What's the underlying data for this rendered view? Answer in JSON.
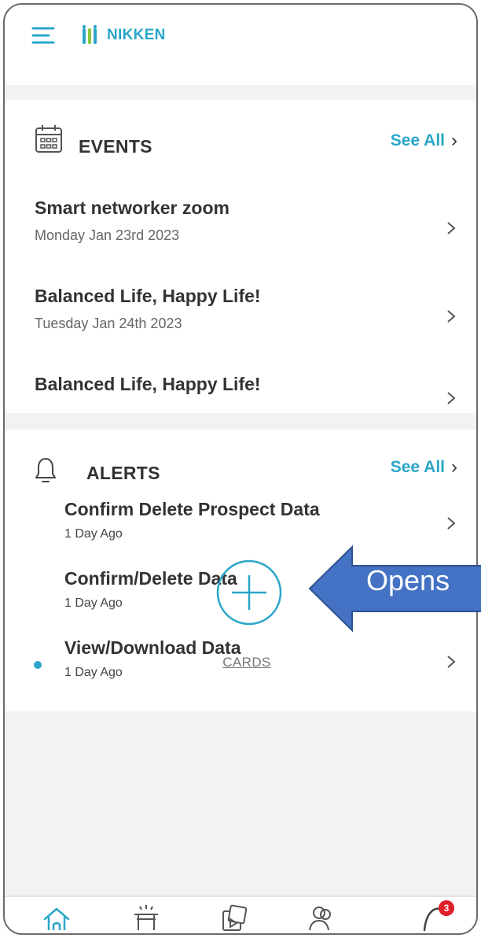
{
  "header": {
    "logo_text": "NIKKEN"
  },
  "events": {
    "title": "EVENTS",
    "see_all": "See All",
    "items": [
      {
        "title": "Smart networker zoom",
        "date": "Monday Jan 23rd 2023"
      },
      {
        "title": "Balanced Life, Happy Life!",
        "date": "Tuesday Jan 24th 2023"
      },
      {
        "title": "Balanced Life, Happy Life!",
        "date": ""
      }
    ]
  },
  "alerts": {
    "title": "ALERTS",
    "see_all": "See All",
    "items": [
      {
        "title": "Confirm Delete Prospect Data",
        "time": "1 Day Ago",
        "unread": false
      },
      {
        "title": "Confirm/Delete Data",
        "time": "1 Day Ago",
        "unread": false
      },
      {
        "title": "View/Download Data",
        "time": "1 Day Ago",
        "unread": true
      }
    ]
  },
  "fab": {
    "label": "CARDS"
  },
  "annotation": {
    "text": "Opens"
  },
  "bottom_nav": {
    "items": [
      "home-icon",
      "events-icon",
      "media-icon",
      "contacts-icon",
      "notifications-icon"
    ],
    "notification_count": "3"
  },
  "colors": {
    "accent": "#2aa6c8",
    "annotation_fill": "#4472c4",
    "badge": "#e0202a"
  }
}
